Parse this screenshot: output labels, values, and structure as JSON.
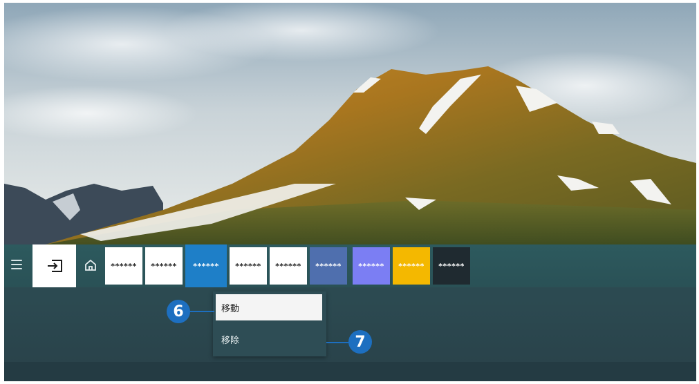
{
  "menu": {
    "icon": "hamburger-menu-icon"
  },
  "source": {
    "icon": "source-input-icon"
  },
  "home": {
    "icon": "home-icon"
  },
  "apps": [
    {
      "label": "******",
      "bg": "#ffffff",
      "fg": "#222222"
    },
    {
      "label": "******",
      "bg": "#ffffff",
      "fg": "#222222"
    },
    {
      "label": "******",
      "bg": "#1e7fc8",
      "fg": "#ffffff",
      "selected": true
    },
    {
      "label": "******",
      "bg": "#ffffff",
      "fg": "#222222"
    },
    {
      "label": "******",
      "bg": "#ffffff",
      "fg": "#222222"
    },
    {
      "label": "******",
      "bg": "#4f6fae",
      "fg": "#ffffff"
    },
    {
      "label": "******",
      "bg": "#7b7ef3",
      "fg": "#ffffff"
    },
    {
      "label": "******",
      "bg": "#f4b800",
      "fg": "#ffffff"
    },
    {
      "label": "******",
      "bg": "#1f2a30",
      "fg": "#ffffff"
    }
  ],
  "context_menu": {
    "move": "移動",
    "remove": "移除"
  },
  "callouts": {
    "move_number": "6",
    "remove_number": "7"
  },
  "colors": {
    "callout": "#1d6fc0",
    "bar": "#2d5a5e"
  }
}
